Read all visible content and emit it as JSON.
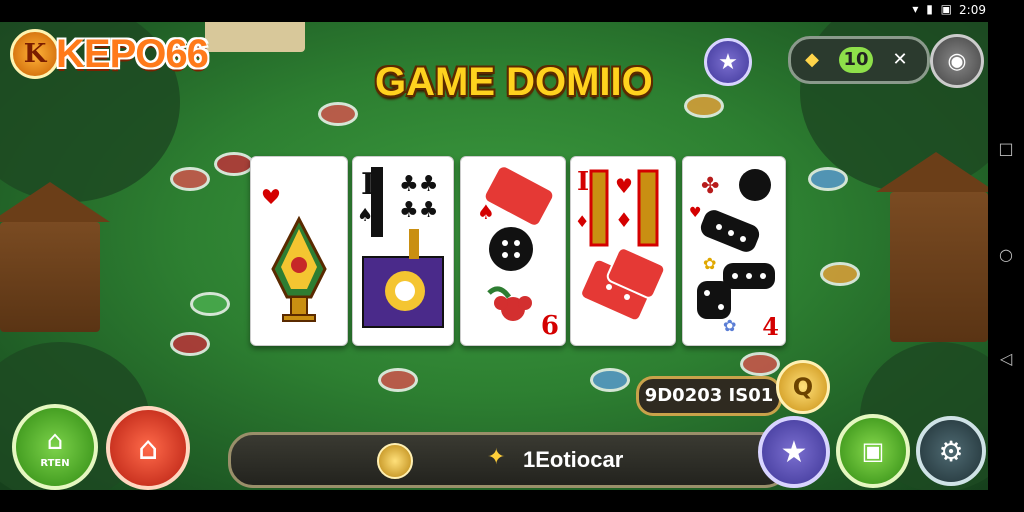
{
  "status": {
    "time": "2:09"
  },
  "logo": {
    "badge_letter": "K",
    "text": "KEPO66"
  },
  "title": "GAME DOMIIO",
  "top_bar": {
    "pill_value": "10"
  },
  "cards": [
    {
      "corner": "",
      "bottom_num": "",
      "suit_color": "#d40000"
    },
    {
      "corner": "I",
      "bottom_num": "",
      "suit_color": "#111111"
    },
    {
      "corner": "",
      "bottom_num": "6",
      "suit_color": "#d40000"
    },
    {
      "corner": "I",
      "bottom_num": "",
      "suit_color": "#d40000"
    },
    {
      "corner": "",
      "bottom_num": "4",
      "suit_color": "#d40000"
    }
  ],
  "balance": {
    "value": "9D0203 IS01"
  },
  "left_buttons": {
    "green_label": "RTEN"
  },
  "bottom_bar": {
    "label": "1Eotiocar"
  },
  "colors": {
    "felt": "#2d7f31",
    "title": "#ffd21e",
    "logo": "#ff7a1a"
  }
}
